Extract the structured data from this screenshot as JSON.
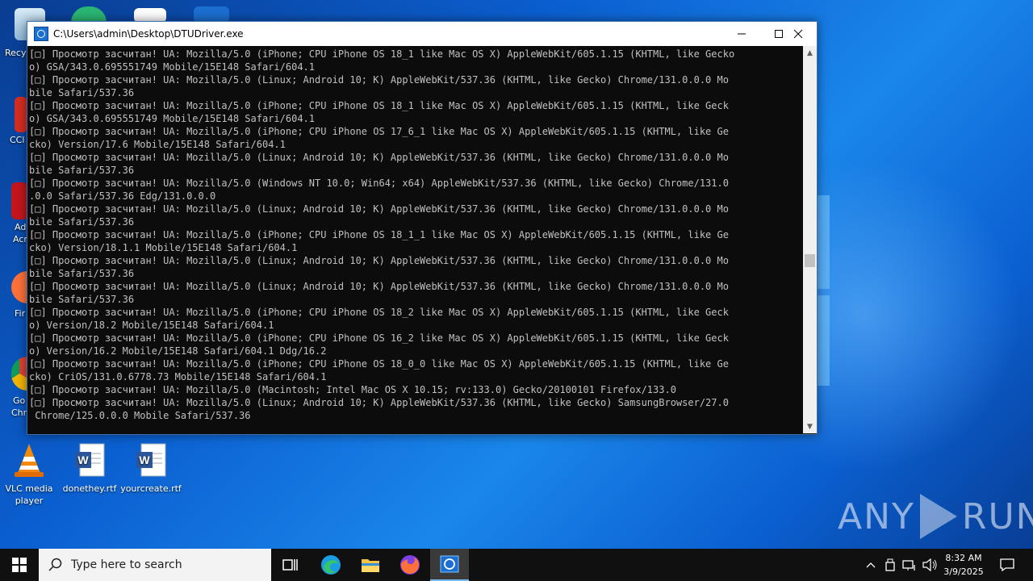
{
  "desktop": {
    "icons": [
      {
        "label": "VLC media player"
      },
      {
        "label": "donethey.rtf"
      },
      {
        "label": "yourcreate.rtf"
      }
    ],
    "partial_labels": [
      "Recy",
      "CCl",
      "Ad",
      "Acr",
      "Fir",
      "Go",
      "Chr"
    ],
    "watermark": {
      "left": "ANY",
      "right": "RUN"
    }
  },
  "window": {
    "title": "C:\\Users\\admin\\Desktop\\DTUDriver.exe",
    "console_lines": [
      "[□] Просмотр засчитан! UA: Mozilla/5.0 (iPhone; CPU iPhone OS 18_1 like Mac OS X) AppleWebKit/605.1.15 (KHTML, like Gecko",
      "o) GSA/343.0.695551749 Mobile/15E148 Safari/604.1",
      "[□] Просмотр засчитан! UA: Mozilla/5.0 (Linux; Android 10; K) AppleWebKit/537.36 (KHTML, like Gecko) Chrome/131.0.0.0 Mo",
      "bile Safari/537.36",
      "[□] Просмотр засчитан! UA: Mozilla/5.0 (iPhone; CPU iPhone OS 18_1 like Mac OS X) AppleWebKit/605.1.15 (KHTML, like Geck",
      "o) GSA/343.0.695551749 Mobile/15E148 Safari/604.1",
      "[□] Просмотр засчитан! UA: Mozilla/5.0 (iPhone; CPU iPhone OS 17_6_1 like Mac OS X) AppleWebKit/605.1.15 (KHTML, like Ge",
      "cko) Version/17.6 Mobile/15E148 Safari/604.1",
      "[□] Просмотр засчитан! UA: Mozilla/5.0 (Linux; Android 10; K) AppleWebKit/537.36 (KHTML, like Gecko) Chrome/131.0.0.0 Mo",
      "bile Safari/537.36",
      "[□] Просмотр засчитан! UA: Mozilla/5.0 (Windows NT 10.0; Win64; x64) AppleWebKit/537.36 (KHTML, like Gecko) Chrome/131.0",
      ".0.0 Safari/537.36 Edg/131.0.0.0",
      "[□] Просмотр засчитан! UA: Mozilla/5.0 (Linux; Android 10; K) AppleWebKit/537.36 (KHTML, like Gecko) Chrome/131.0.0.0 Mo",
      "bile Safari/537.36",
      "[□] Просмотр засчитан! UA: Mozilla/5.0 (iPhone; CPU iPhone OS 18_1_1 like Mac OS X) AppleWebKit/605.1.15 (KHTML, like Ge",
      "cko) Version/18.1.1 Mobile/15E148 Safari/604.1",
      "[□] Просмотр засчитан! UA: Mozilla/5.0 (Linux; Android 10; K) AppleWebKit/537.36 (KHTML, like Gecko) Chrome/131.0.0.0 Mo",
      "bile Safari/537.36",
      "[□] Просмотр засчитан! UA: Mozilla/5.0 (Linux; Android 10; K) AppleWebKit/537.36 (KHTML, like Gecko) Chrome/131.0.0.0 Mo",
      "bile Safari/537.36",
      "[□] Просмотр засчитан! UA: Mozilla/5.0 (iPhone; CPU iPhone OS 18_2 like Mac OS X) AppleWebKit/605.1.15 (KHTML, like Geck",
      "o) Version/18.2 Mobile/15E148 Safari/604.1",
      "[□] Просмотр засчитан! UA: Mozilla/5.0 (iPhone; CPU iPhone OS 16_2 like Mac OS X) AppleWebKit/605.1.15 (KHTML, like Geck",
      "o) Version/16.2 Mobile/15E148 Safari/604.1 Ddg/16.2",
      "[□] Просмотр засчитан! UA: Mozilla/5.0 (iPhone; CPU iPhone OS 18_0_0 like Mac OS X) AppleWebKit/605.1.15 (KHTML, like Ge",
      "cko) CriOS/131.0.6778.73 Mobile/15E148 Safari/604.1",
      "[□] Просмотр засчитан! UA: Mozilla/5.0 (Macintosh; Intel Mac OS X 10.15; rv:133.0) Gecko/20100101 Firefox/133.0",
      "[□] Просмотр засчитан! UA: Mozilla/5.0 (Linux; Android 10; K) AppleWebKit/537.36 (KHTML, like Gecko) SamsungBrowser/27.0",
      " Chrome/125.0.0.0 Mobile Safari/537.36"
    ]
  },
  "taskbar": {
    "search_placeholder": "Type here to search",
    "clock_time": "8:32 AM",
    "clock_date": "3/9/2025",
    "accent_color": "#76b9ed"
  }
}
